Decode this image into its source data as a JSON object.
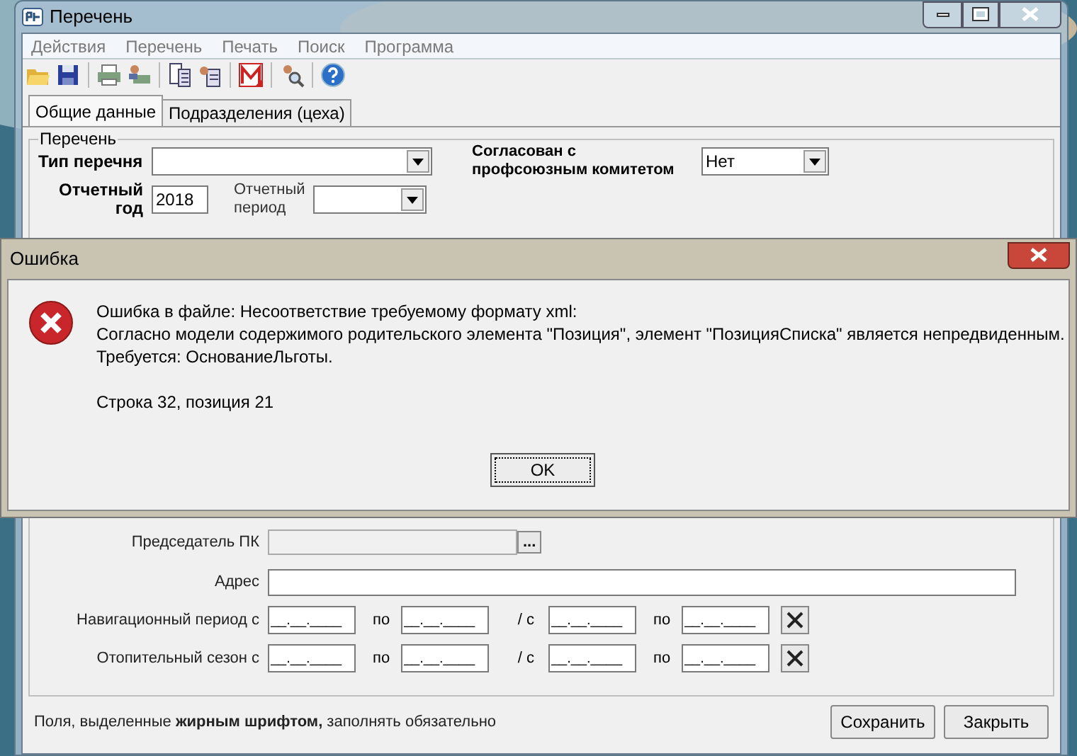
{
  "main_window": {
    "title": "Перечень",
    "menu": [
      "Действия",
      "Перечень",
      "Печать",
      "Поиск",
      "Программа"
    ],
    "tabs": [
      {
        "label": "Общие данные",
        "selected": true
      },
      {
        "label": "Подразделения (цеха)",
        "selected": false
      }
    ],
    "group_title": "Перечень",
    "list_type": {
      "label": "Тип перечня"
    },
    "agreed": {
      "label_lines": [
        "Согласован с",
        "профсоюзным комитетом"
      ],
      "value": "Нет"
    },
    "report_year": {
      "label": "Отчетный год",
      "value": "2018"
    },
    "report_period": {
      "label": "Отчетный период"
    },
    "chairman": {
      "label": "Председатель ПК",
      "button": "..."
    },
    "address": {
      "label": "Адрес"
    },
    "period_rows": [
      {
        "label": "Навигационный период с",
        "to_1": "по",
        "slash": "/ с",
        "to_2": "по",
        "dates": [
          "__.__.____",
          "__.__.____",
          "__.__.____",
          "__.__.____"
        ]
      },
      {
        "label": "Отопительный сезон с",
        "to_1": "по",
        "slash": "/ с",
        "to_2": "по",
        "dates": [
          "__.__.____",
          "__.__.____",
          "__.__.____",
          "__.__.____"
        ]
      }
    ],
    "footer_note": "Поля, выделенные **жирным шрифтом,** заполнять обязательно",
    "buttons": [
      "Сохранить",
      "Закрыть"
    ]
  },
  "dialog": {
    "title": "Ошибка",
    "message_lines": [
      "Ошибка в файле: Несоответствие требуемому формату xml:",
      "Согласно модели содержимого родительского элемента \"Позиция\", элемент \"ПозицияСписка\" является непредвиденным.",
      "Требуется: ОснованиеЛьготы."
    ],
    "position": "Строка 32, позиция 21",
    "button": "OK"
  }
}
